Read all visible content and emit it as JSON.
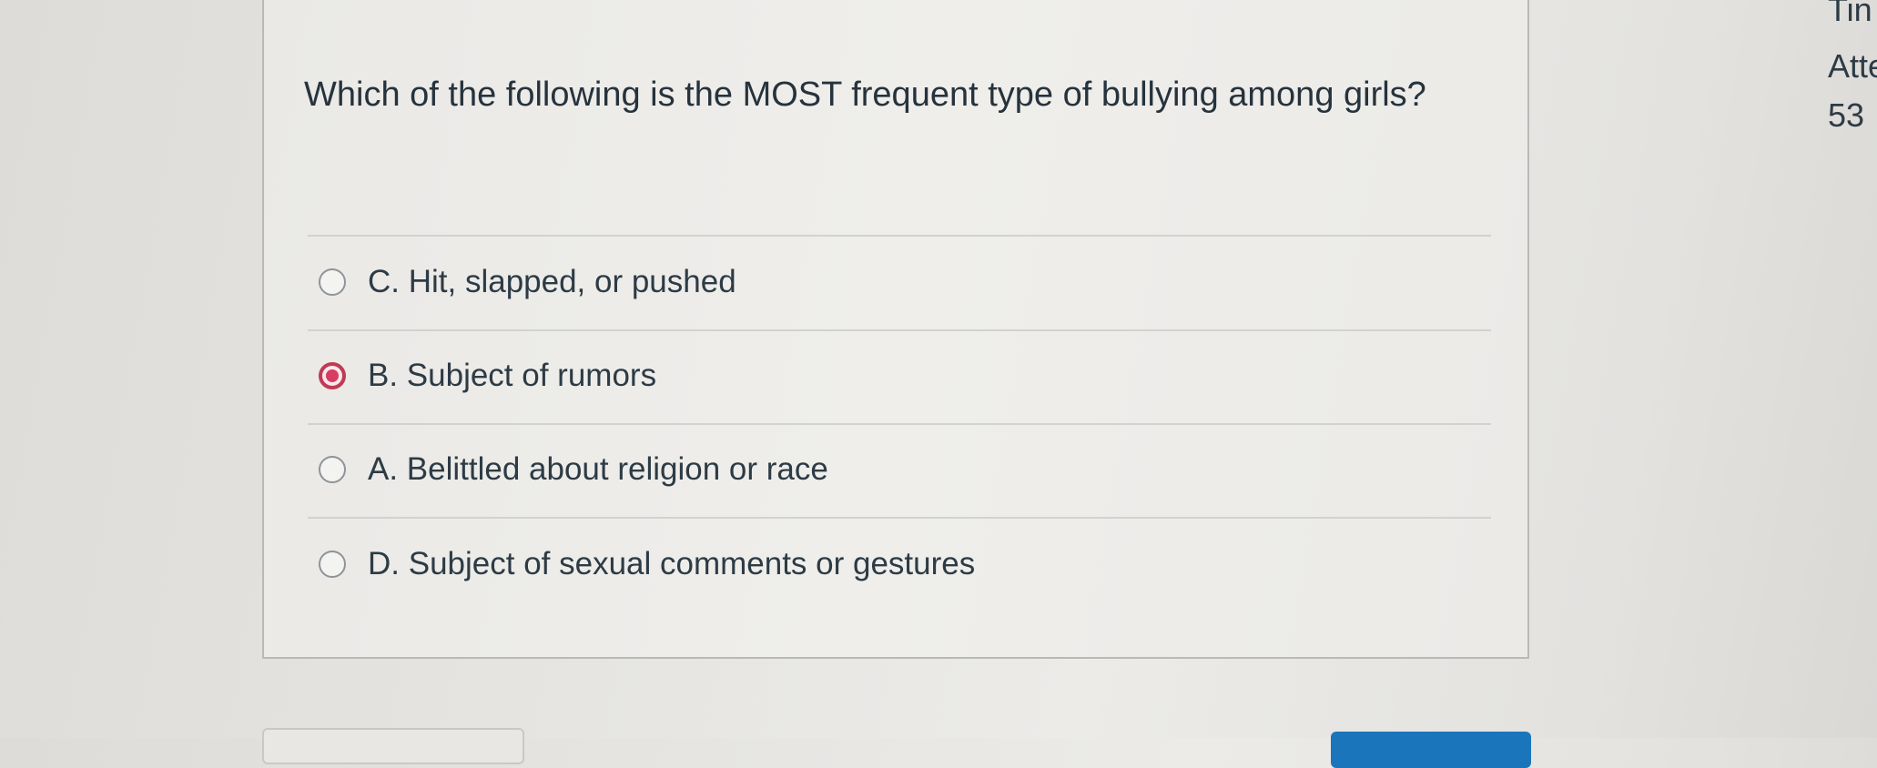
{
  "question": {
    "text": "Which of the following is the MOST frequent type of bullying among girls?"
  },
  "answers": [
    {
      "label": "C. Hit, slapped, or pushed",
      "selected": false
    },
    {
      "label": "B. Subject of rumors",
      "selected": true
    },
    {
      "label": "A. Belittled about religion or race",
      "selected": false
    },
    {
      "label": "D. Subject of sexual comments or gestures",
      "selected": false
    }
  ],
  "side_panel": {
    "time_label_partial": "Tin",
    "attempt_label_partial": "Atte",
    "attempt_value_partial": "53"
  },
  "colors": {
    "selected_radio": "#d83c60",
    "text": "#2d3b45",
    "primary_button": "#1b75bb"
  }
}
